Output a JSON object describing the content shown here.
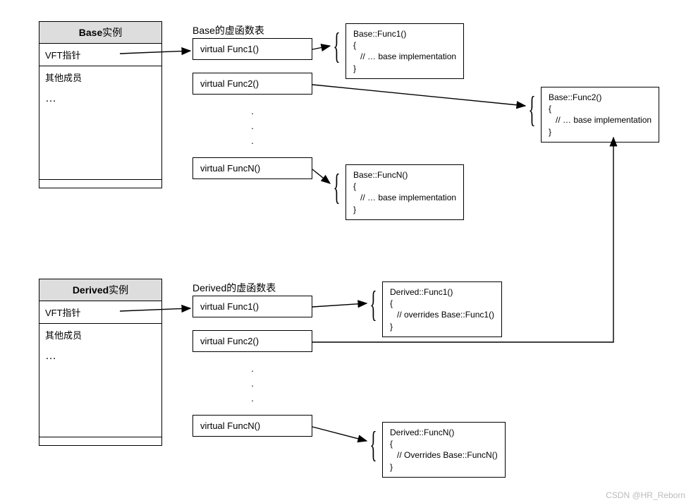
{
  "base": {
    "instance_title_bold": "Base",
    "instance_title_suffix": "实例",
    "vft_row": "VFT指针",
    "members_row": "其他成员",
    "ellipsis": "…",
    "vtable_title": "Base的虚函数表",
    "vtable_rows": {
      "r1": "virtual Func1()",
      "r2": "virtual Func2()",
      "rN": "virtual FuncN()"
    },
    "code_func1": "Base::Func1()\n{\n   // … base implementation\n}",
    "code_func2": "Base::Func2()\n{\n   // … base implementation\n}",
    "code_funcN": "Base::FuncN()\n{\n   // … base implementation\n}"
  },
  "derived": {
    "instance_title_bold": "Derived",
    "instance_title_suffix": "实例",
    "vft_row": "VFT指针",
    "members_row": "其他成员",
    "ellipsis": "…",
    "vtable_title": "Derived的虚函数表",
    "vtable_rows": {
      "r1": "virtual Func1()",
      "r2": "virtual Func2()",
      "rN": "virtual FuncN()"
    },
    "code_func1": "Derived::Func1()\n{\n   // overrides Base::Func1()\n}",
    "code_funcN": "Derived::FuncN()\n{\n   // Overrides Base::FuncN()\n}"
  },
  "dots": ".\n.\n.",
  "watermark": "CSDN @HR_Reborn"
}
